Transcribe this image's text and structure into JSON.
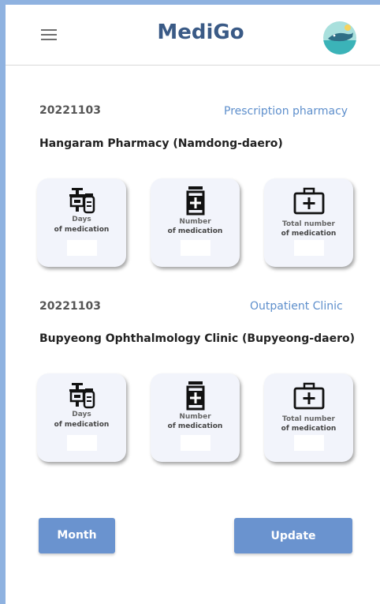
{
  "app": {
    "title": "MediGo"
  },
  "records": [
    {
      "date": "20221103",
      "type": "Prescription pharmacy",
      "place": "Hangaram Pharmacy (Namdong-daero)",
      "cards": [
        {
          "icon": "pills-icon",
          "line1": "Days",
          "line2": "of medication"
        },
        {
          "icon": "medicine-bottle-icon",
          "line1": "Number",
          "line2": "of medication"
        },
        {
          "icon": "first-aid-kit-icon",
          "line1": "Total number",
          "line2": "of medication"
        }
      ]
    },
    {
      "date": "20221103",
      "type": "Outpatient Clinic",
      "place": "Bupyeong Ophthalmology Clinic (Bupyeong-daero)",
      "cards": [
        {
          "icon": "pills-icon",
          "line1": "Days",
          "line2": "of medication"
        },
        {
          "icon": "medicine-bottle-icon",
          "line1": "Number",
          "line2": "of medication"
        },
        {
          "icon": "first-aid-kit-icon",
          "line1": "Total number",
          "line2": "of medication"
        }
      ]
    }
  ],
  "buttons": {
    "month": "Month",
    "update": "Update"
  },
  "colors": {
    "accent": "#6a93cf",
    "title": "#3a5a86",
    "link": "#5e8fcc",
    "frame": "#8fb2e0"
  }
}
